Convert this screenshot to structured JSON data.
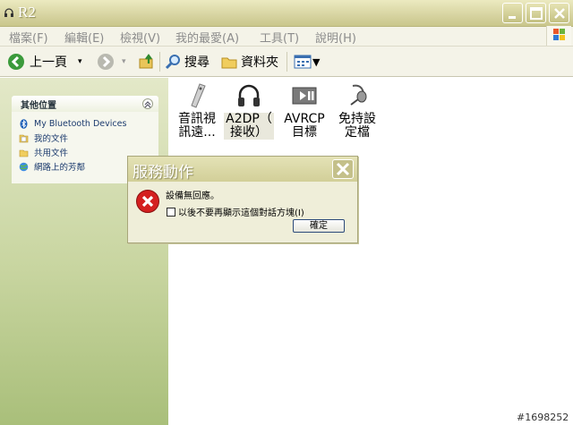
{
  "window": {
    "title": "R2"
  },
  "menu": [
    "檔案(F)",
    "編輯(E)",
    "檢視(V)",
    "我的最愛(A)",
    "工具(T)",
    "說明(H)"
  ],
  "toolbar": {
    "back_label": "上一頁",
    "search_label": "搜尋",
    "folders_label": "資料夾"
  },
  "left_panel": {
    "header": "其他位置",
    "links": [
      "My Bluetooth Devices",
      "我的文件",
      "共用文件",
      "網路上的芳鄰"
    ]
  },
  "files": [
    {
      "line1": "音訊視",
      "line2": "訊遠..."
    },
    {
      "line1": "A2DP（",
      "line2": "接收）"
    },
    {
      "line1": "AVRCP",
      "line2": "目標"
    },
    {
      "line1": "免持設",
      "line2": "定檔"
    }
  ],
  "dialog": {
    "title": "服務動作",
    "message": "設備無回應。",
    "checkbox_label": "以後不要再顯示這個對話方塊(I)",
    "ok_label": "確定"
  },
  "watermark": "#1698252"
}
